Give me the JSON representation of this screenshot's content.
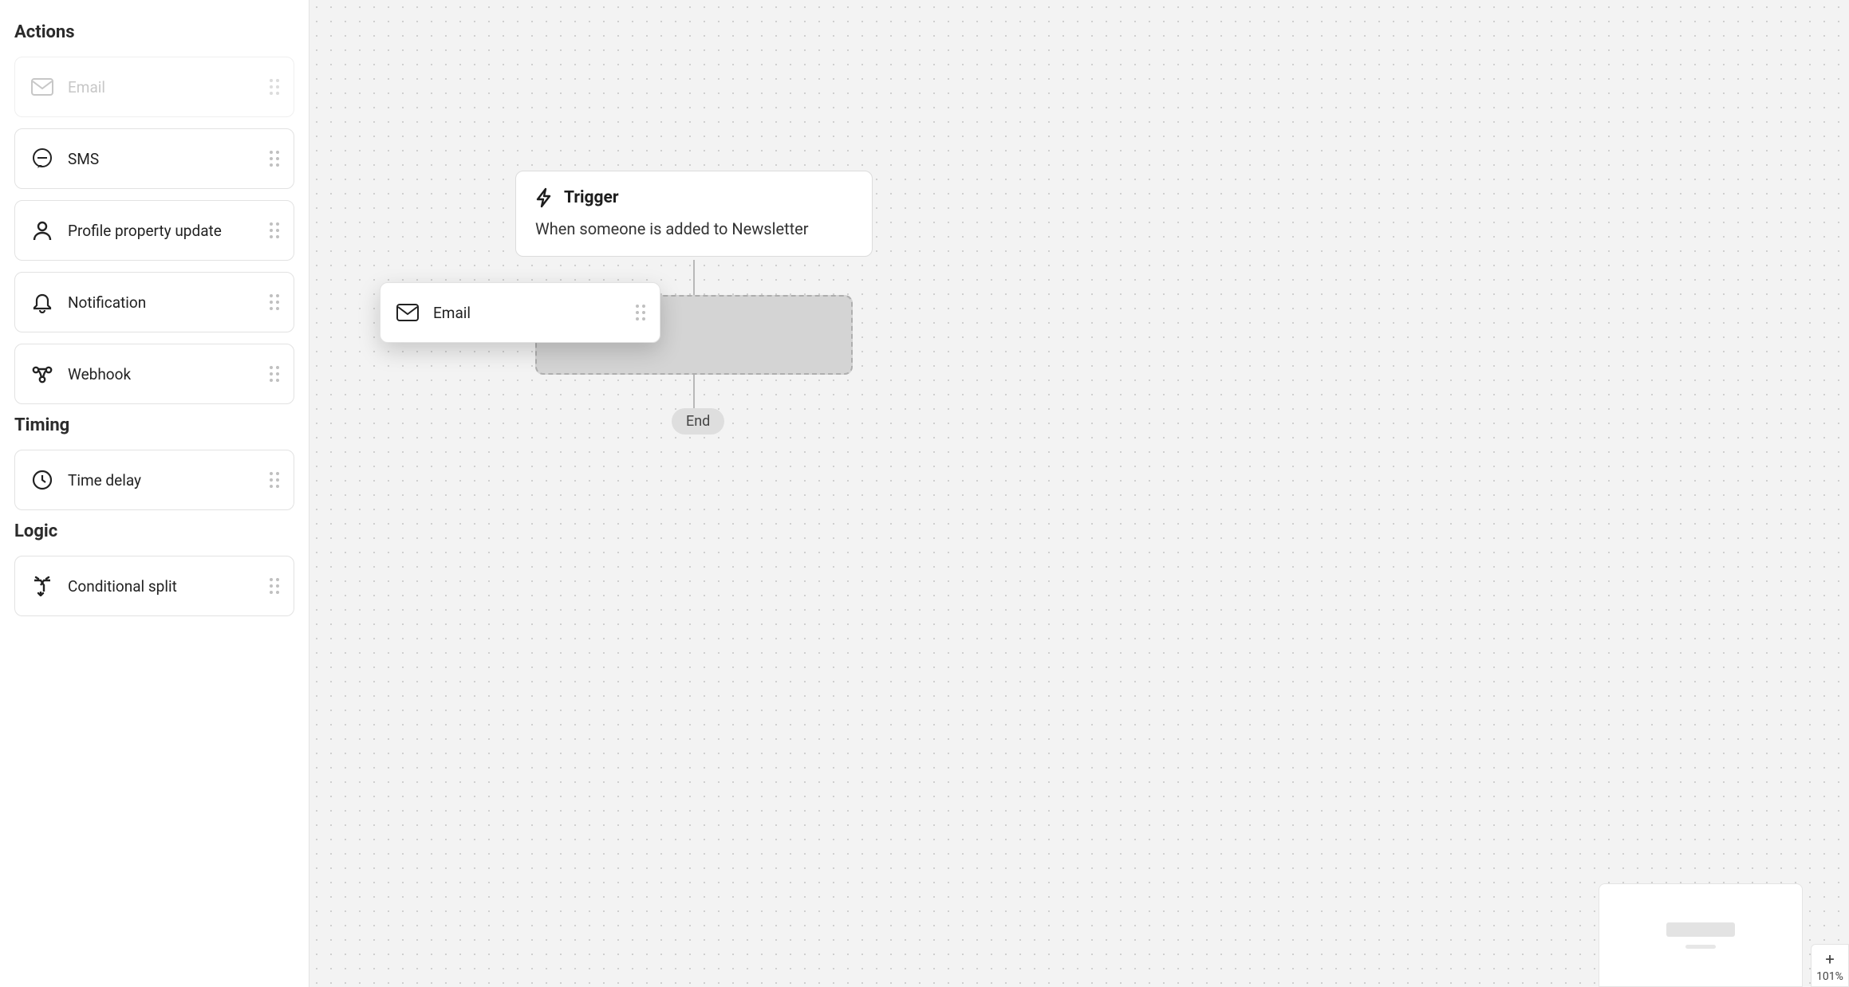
{
  "sidebar": {
    "sections": {
      "actions": {
        "title": "Actions",
        "items": [
          {
            "label": "Email",
            "icon": "mail-icon",
            "dragged": true
          },
          {
            "label": "SMS",
            "icon": "sms-icon"
          },
          {
            "label": "Profile property update",
            "icon": "profile-icon"
          },
          {
            "label": "Notification",
            "icon": "bell-icon"
          },
          {
            "label": "Webhook",
            "icon": "webhook-icon"
          }
        ]
      },
      "timing": {
        "title": "Timing",
        "items": [
          {
            "label": "Time delay",
            "icon": "clock-icon"
          }
        ]
      },
      "logic": {
        "title": "Logic",
        "items": [
          {
            "label": "Conditional split",
            "icon": "split-icon"
          }
        ]
      }
    }
  },
  "canvas": {
    "trigger": {
      "title": "Trigger",
      "description": "When someone is added to Newsletter"
    },
    "dragging": {
      "label": "Email"
    },
    "end_label": "End"
  },
  "zoom": {
    "level": "101%",
    "in_label": "+"
  }
}
